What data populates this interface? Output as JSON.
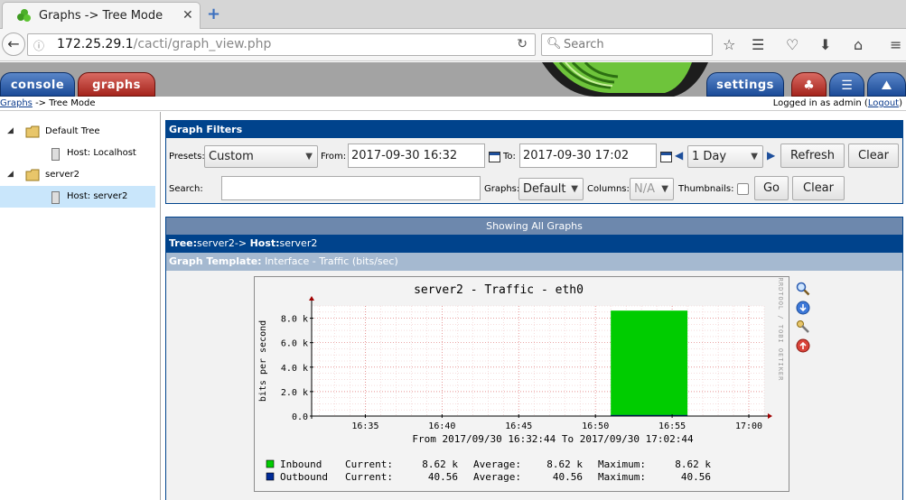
{
  "browser": {
    "tab_title": "Graphs -> Tree Mode",
    "url_host": "172.25.29.1",
    "url_path": "/cacti/graph_view.php",
    "search_placeholder": "Search"
  },
  "cacti": {
    "tabs": {
      "console": "console",
      "graphs": "graphs",
      "settings": "settings"
    },
    "breadcrumb": {
      "link": "Graphs",
      "rest": " -> Tree Mode"
    },
    "login": {
      "prefix": "Logged in as admin (",
      "logout": "Logout",
      "suffix": ")"
    }
  },
  "tree": {
    "items": [
      {
        "label": "Default Tree"
      },
      {
        "label": "Host: Localhost"
      },
      {
        "label": "server2"
      },
      {
        "label": "Host: server2"
      }
    ]
  },
  "filters": {
    "title": "Graph Filters",
    "presets_label": "Presets:",
    "presets_value": "Custom",
    "from_label": "From:",
    "from_value": "2017-09-30 16:32",
    "to_label": "To:",
    "to_value": "2017-09-30 17:02",
    "span_value": "1 Day",
    "refresh": "Refresh",
    "clear": "Clear",
    "search_label": "Search:",
    "graphs_label": "Graphs:",
    "graphs_value": "Default",
    "columns_label": "Columns:",
    "columns_value": "N/A",
    "thumbnails_label": "Thumbnails:",
    "go": "Go",
    "clear2": "Clear"
  },
  "panel": {
    "header": "Showing All Graphs",
    "tree_label": "Tree:",
    "tree_value": "server2",
    "tree_sep": "->",
    "host_label": "Host:",
    "host_value": "server2",
    "template_label": "Graph Template:",
    "template_value": "Interface - Traffic (bits/sec)"
  },
  "colors": {
    "inbound": "#00cc00",
    "outbound": "#002a97",
    "accent": "#00438c"
  },
  "chart_data": {
    "type": "area",
    "title": "server2 - Traffic - eth0",
    "ylabel": "bits per second",
    "watermark": "RRDTOOL / TOBI OETIKER",
    "x_caption": "From 2017/09/30 16:32:44 To 2017/09/30 17:02:44",
    "xticks": [
      "16:35",
      "16:40",
      "16:45",
      "16:50",
      "16:55",
      "17:00"
    ],
    "yticks": [
      "0.0",
      "2.0 k",
      "4.0 k",
      "6.0 k",
      "8.0 k"
    ],
    "ylim": [
      0,
      9000
    ],
    "xlim_minutes": [
      16.5,
      46.0
    ],
    "grid": true,
    "series": [
      {
        "name": "Inbound",
        "x_minutes_from_1630": [
          36.0,
          41.0
        ],
        "value": 8620,
        "legend": [
          "Current:",
          "8.62 k",
          "Average:",
          "8.62 k",
          "Maximum:",
          "8.62 k"
        ]
      },
      {
        "name": "Outbound",
        "x_minutes_from_1630": [
          36.0,
          41.0
        ],
        "value": 40.56,
        "legend": [
          "Current:",
          "40.56",
          "Average:",
          "40.56",
          "Maximum:",
          "40.56"
        ]
      }
    ]
  }
}
